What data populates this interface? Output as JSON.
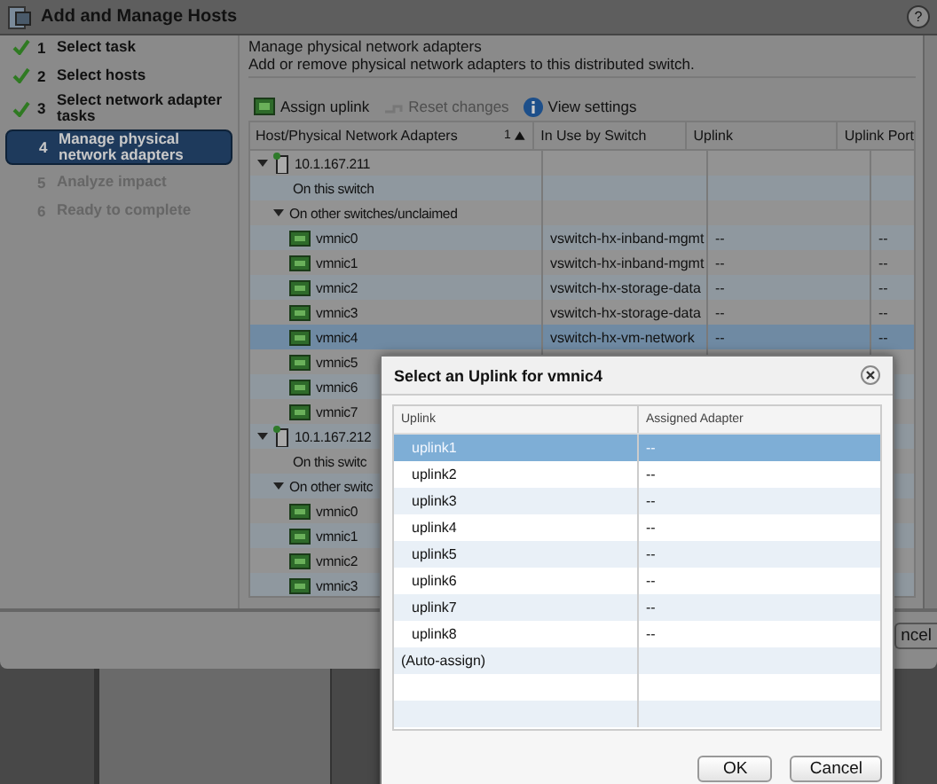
{
  "window": {
    "title": "Add and Manage Hosts",
    "help": "?"
  },
  "steps": [
    {
      "number": "1",
      "label": "Select task",
      "completed": true,
      "selected": false
    },
    {
      "number": "2",
      "label": "Select hosts",
      "completed": true,
      "selected": false
    },
    {
      "number": "3",
      "label": "Select network adapter tasks",
      "completed": true,
      "selected": false
    },
    {
      "number": "4",
      "label": "Manage physical network adapters",
      "completed": false,
      "selected": true
    },
    {
      "number": "5",
      "label": "Analyze impact",
      "completed": false,
      "selected": false
    },
    {
      "number": "6",
      "label": "Ready to complete",
      "completed": false,
      "selected": false
    }
  ],
  "content": {
    "heading": "Manage physical network adapters",
    "description": "Add or remove physical network adapters to this distributed switch."
  },
  "toolbar": [
    {
      "kind": "assign",
      "label": "Assign uplink",
      "disabled": false
    },
    {
      "kind": "reset",
      "label": "Reset changes",
      "disabled": true
    },
    {
      "kind": "info",
      "label": "View settings",
      "disabled": false
    }
  ],
  "table": {
    "columns": [
      "Host/Physical Network Adapters",
      "In Use by Switch",
      "Uplink",
      "Uplink Port"
    ],
    "sort_order": "1",
    "rows": [
      {
        "kind": "host",
        "label": "10.1.167.211",
        "expanded": true,
        "children": [
          {
            "kind": "group",
            "label": "On this switch"
          },
          {
            "kind": "group",
            "label": "On other switches/unclaimed",
            "expanded": true,
            "children": [
              {
                "kind": "adapter",
                "label": "vmnic0",
                "switch": "vswitch-hx-inband-mgmt",
                "uplink": "--",
                "uplink_port": "--",
                "selected": false
              },
              {
                "kind": "adapter",
                "label": "vmnic1",
                "switch": "vswitch-hx-inband-mgmt",
                "uplink": "--",
                "uplink_port": "--",
                "selected": false
              },
              {
                "kind": "adapter",
                "label": "vmnic2",
                "switch": "vswitch-hx-storage-data",
                "uplink": "--",
                "uplink_port": "--",
                "selected": false
              },
              {
                "kind": "adapter",
                "label": "vmnic3",
                "switch": "vswitch-hx-storage-data",
                "uplink": "--",
                "uplink_port": "--",
                "selected": false
              },
              {
                "kind": "adapter",
                "label": "vmnic4",
                "switch": "vswitch-hx-vm-network",
                "uplink": "--",
                "uplink_port": "--",
                "selected": true
              },
              {
                "kind": "adapter",
                "label": "vmnic5",
                "selected": false
              },
              {
                "kind": "adapter",
                "label": "vmnic6",
                "selected": false
              },
              {
                "kind": "adapter",
                "label": "vmnic7",
                "selected": false
              }
            ]
          }
        ]
      },
      {
        "kind": "host",
        "label": "10.1.167.212",
        "expanded": true,
        "children": [
          {
            "kind": "group",
            "label": "On this switc"
          },
          {
            "kind": "group",
            "label": "On other switc",
            "expanded": true,
            "children": [
              {
                "kind": "adapter",
                "label": "vmnic0",
                "selected": false
              },
              {
                "kind": "adapter",
                "label": "vmnic1",
                "selected": false
              },
              {
                "kind": "adapter",
                "label": "vmnic2",
                "selected": false
              },
              {
                "kind": "adapter",
                "label": "vmnic3",
                "selected": false
              }
            ]
          }
        ]
      }
    ]
  },
  "footer": {
    "cancel_button": "ncel"
  },
  "dialog": {
    "title": "Select an Uplink for vmnic4",
    "columns": [
      "Uplink",
      "Assigned Adapter"
    ],
    "rows": [
      {
        "uplink": "uplink1",
        "adapter": "--",
        "selected": true
      },
      {
        "uplink": "uplink2",
        "adapter": "--",
        "selected": false
      },
      {
        "uplink": "uplink3",
        "adapter": "--",
        "selected": false
      },
      {
        "uplink": "uplink4",
        "adapter": "--",
        "selected": false
      },
      {
        "uplink": "uplink5",
        "adapter": "--",
        "selected": false
      },
      {
        "uplink": "uplink6",
        "adapter": "--",
        "selected": false
      },
      {
        "uplink": "uplink7",
        "adapter": "--",
        "selected": false
      },
      {
        "uplink": "uplink8",
        "adapter": "--",
        "selected": false
      },
      {
        "uplink": "(Auto-assign)",
        "selected": false
      }
    ],
    "buttons": [
      "OK",
      "Cancel"
    ]
  }
}
